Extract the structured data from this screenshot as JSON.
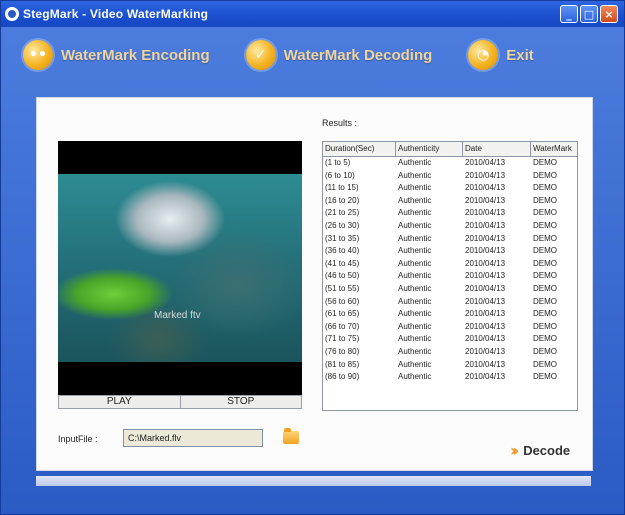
{
  "window": {
    "title": "StegMark - Video WaterMarking",
    "controls": [
      {
        "name": "minimize",
        "glyph": "_"
      },
      {
        "name": "maximize",
        "glyph": "□"
      },
      {
        "name": "close",
        "glyph": "×"
      }
    ]
  },
  "toolbar": {
    "items": [
      {
        "label": "WaterMark Encoding",
        "icon": "encode-icon"
      },
      {
        "label": "WaterMark Decoding",
        "icon": "decode-check-icon"
      },
      {
        "label": "Exit",
        "icon": "exit-icon"
      }
    ]
  },
  "video": {
    "watermark_text": "Marked ftv",
    "play_label": "PLAY",
    "stop_label": "STOP"
  },
  "results": {
    "label": "Results :",
    "columns": [
      "Duration(Sec)",
      "Authenticity",
      "Date",
      "WaterMark"
    ],
    "rows": [
      [
        "(1 to 5)",
        "Authentic",
        "2010/04/13",
        "DEMO"
      ],
      [
        "(6 to 10)",
        "Authentic",
        "2010/04/13",
        "DEMO"
      ],
      [
        "(11 to 15)",
        "Authentic",
        "2010/04/13",
        "DEMO"
      ],
      [
        "(16 to 20)",
        "Authentic",
        "2010/04/13",
        "DEMO"
      ],
      [
        "(21 to 25)",
        "Authentic",
        "2010/04/13",
        "DEMO"
      ],
      [
        "(26 to 30)",
        "Authentic",
        "2010/04/13",
        "DEMO"
      ],
      [
        "(31 to 35)",
        "Authentic",
        "2010/04/13",
        "DEMO"
      ],
      [
        "(36 to 40)",
        "Authentic",
        "2010/04/13",
        "DEMO"
      ],
      [
        "(41 to 45)",
        "Authentic",
        "2010/04/13",
        "DEMO"
      ],
      [
        "(46 to 50)",
        "Authentic",
        "2010/04/13",
        "DEMO"
      ],
      [
        "(51 to 55)",
        "Authentic",
        "2010/04/13",
        "DEMO"
      ],
      [
        "(56 to 60)",
        "Authentic",
        "2010/04/13",
        "DEMO"
      ],
      [
        "(61 to 65)",
        "Authentic",
        "2010/04/13",
        "DEMO"
      ],
      [
        "(66 to 70)",
        "Authentic",
        "2010/04/13",
        "DEMO"
      ],
      [
        "(71 to 75)",
        "Authentic",
        "2010/04/13",
        "DEMO"
      ],
      [
        "(76 to 80)",
        "Authentic",
        "2010/04/13",
        "DEMO"
      ],
      [
        "(81 to 85)",
        "Authentic",
        "2010/04/13",
        "DEMO"
      ],
      [
        "(86 to 90)",
        "Authentic",
        "2010/04/13",
        "DEMO"
      ]
    ]
  },
  "input": {
    "label": "InputFile :",
    "value": "C:\\Marked.flv"
  },
  "decode": {
    "label": "Decode",
    "icon": "double-chevron-right-icon"
  },
  "colors": {
    "title_bar": "#1a4fd0",
    "toolbar_text": "#f1d49a",
    "icon_orange": "#f4b21f",
    "decode_chevron": "#f09018"
  }
}
